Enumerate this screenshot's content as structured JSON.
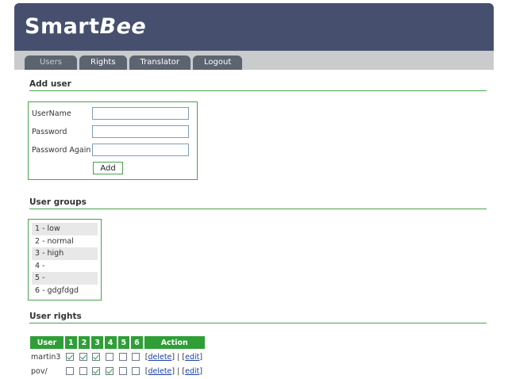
{
  "app": {
    "name_plain": "Smart",
    "name_italic": "Bee"
  },
  "nav": {
    "tabs": [
      {
        "label": "Users",
        "active": true
      },
      {
        "label": "Rights",
        "active": false
      },
      {
        "label": "Translator",
        "active": false
      },
      {
        "label": "Logout",
        "active": false
      }
    ]
  },
  "add_user": {
    "title": "Add user",
    "username_label": "UserName",
    "password_label": "Password",
    "password_again_label": "Password Again",
    "username_value": "",
    "password_value": "",
    "password_again_value": "",
    "add_button": "Add"
  },
  "user_groups": {
    "title": "User groups",
    "items": [
      "1 - low",
      "2 - normal",
      "3 - high",
      "4 -",
      "5 -",
      "6 - gdgfdgd"
    ]
  },
  "user_rights": {
    "title": "User rights",
    "headers": [
      "User",
      "1",
      "2",
      "3",
      "4",
      "5",
      "6",
      "Action"
    ],
    "rows": [
      {
        "user": "martin3",
        "rights": [
          true,
          true,
          true,
          false,
          false,
          false
        ],
        "delete": "delete",
        "edit": "edit",
        "separator": "|"
      },
      {
        "user": "pov/",
        "rights": [
          false,
          false,
          true,
          true,
          false,
          false
        ],
        "delete": "delete",
        "edit": "edit",
        "separator": "|"
      }
    ]
  },
  "colors": {
    "header": "#46506e",
    "navbar": "#c9cbcc",
    "accent_green": "#2f9e37",
    "link": "#1a3fa3"
  }
}
